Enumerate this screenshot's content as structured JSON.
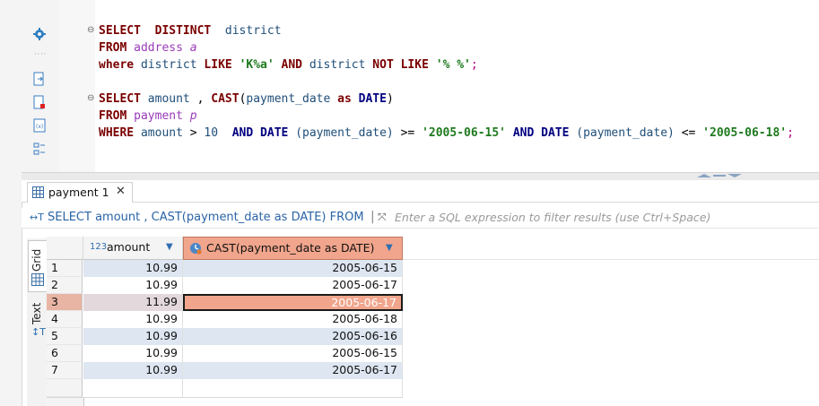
{
  "editor": {
    "query1": {
      "line1": {
        "kw1": "SELECT",
        "kw2": "DISTINCT",
        "col": "district"
      },
      "line2": {
        "kw": "FROM",
        "table": "address",
        "alias": "a"
      },
      "line3": {
        "kw1": "where",
        "col1": "district",
        "kw2": "LIKE",
        "str1": "'K%a'",
        "kw3": "AND",
        "col2": "district",
        "kw4": "NOT",
        "kw5": "LIKE",
        "str2": "'% %'",
        "semi": ";"
      }
    },
    "query2": {
      "line1": {
        "kw1": "SELECT",
        "col1": "amount",
        "comma": ",",
        "fn": "CAST",
        "lp": "(",
        "col2": "payment_date",
        "kw2": "as",
        "type": "DATE",
        "rp": ")"
      },
      "line2": {
        "kw": "FROM",
        "table": "payment",
        "alias": "p"
      },
      "line3": {
        "kw1": "WHERE",
        "col1": "amount",
        "op1": ">",
        "num": "10",
        "kw2": "AND",
        "fn1": "DATE",
        "arg1": "(payment_date)",
        "op2": ">=",
        "str1": "'2005-06-15'",
        "kw3": "AND",
        "fn2": "DATE",
        "arg2": "(payment_date)",
        "op3": "<=",
        "str2": "'2005-06-18'",
        "semi": ";"
      }
    }
  },
  "results": {
    "tab_label": "payment 1",
    "filter_query": "SELECT amount , CAST(payment_date as DATE) FROM",
    "filter_placeholder": "Enter a SQL expression to filter results (use Ctrl+Space)",
    "side_tabs": [
      "Grid",
      "Text"
    ],
    "columns": [
      {
        "type_badge": "123",
        "label": "amount"
      },
      {
        "label": "CAST(payment_date as DATE)"
      }
    ],
    "rows": [
      {
        "n": "1",
        "amount": "10.99",
        "date": "2005-06-15"
      },
      {
        "n": "2",
        "amount": "10.99",
        "date": "2005-06-17"
      },
      {
        "n": "3",
        "amount": "11.99",
        "date": "2005-06-17"
      },
      {
        "n": "4",
        "amount": "10.99",
        "date": "2005-06-18"
      },
      {
        "n": "5",
        "amount": "10.99",
        "date": "2005-06-16"
      },
      {
        "n": "6",
        "amount": "10.99",
        "date": "2005-06-15"
      },
      {
        "n": "7",
        "amount": "10.99",
        "date": "2005-06-17"
      }
    ],
    "selected_row": 3
  },
  "colors": {
    "selected_header": "#f0a58c",
    "selected_cell": "#f0a58c",
    "stripe": "#dde6f1"
  }
}
